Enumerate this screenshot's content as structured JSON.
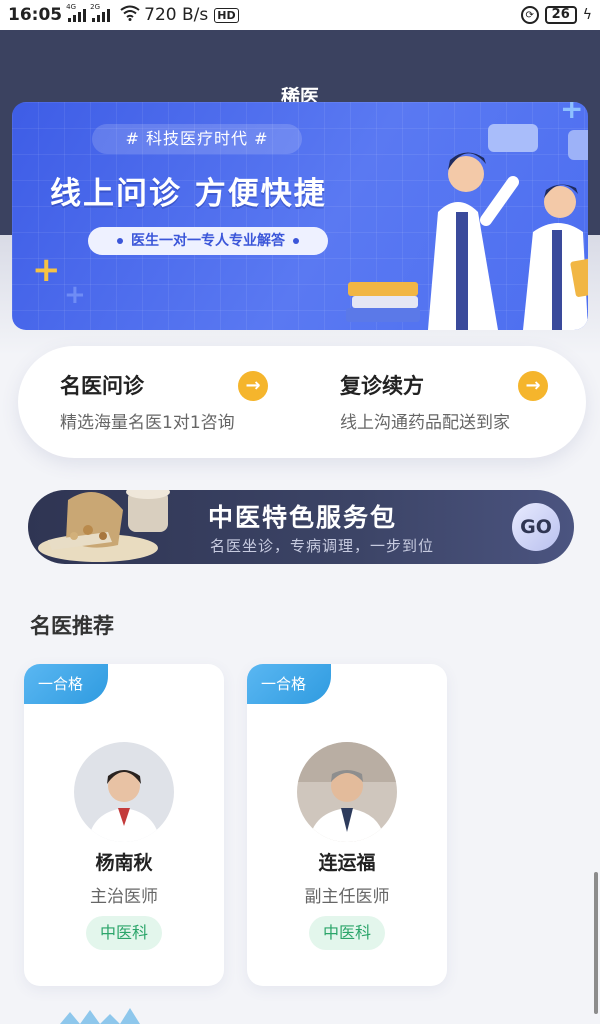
{
  "status_bar": {
    "time": "16:05",
    "network1": "4G",
    "network2": "2G",
    "speed": "720 B/s",
    "hd_label": "HD",
    "battery": "26"
  },
  "header": {
    "title": "稀医"
  },
  "banner": {
    "tagline": "# 科技医疗时代 #",
    "headline": "线上问诊 方便快捷",
    "pill_text": "医生一对一专人专业解答"
  },
  "services": [
    {
      "title": "名医问诊",
      "subtitle": "精选海量名医1对1咨询",
      "arrow": "→"
    },
    {
      "title": "复诊续方",
      "subtitle": "线上沟通药品配送到家",
      "arrow": "→"
    }
  ],
  "tcm_banner": {
    "title": "中医特色服务包",
    "subtitle": "名医坐诊，专病调理，一步到位",
    "button": "GO"
  },
  "section": {
    "title": "名医推荐"
  },
  "doctors": [
    {
      "badge": "一合格",
      "name": "杨南秋",
      "title": "主治医师",
      "department": "中医科"
    },
    {
      "badge": "一合格",
      "name": "连运福",
      "title": "副主任医师",
      "department": "中医科"
    }
  ],
  "colors": {
    "header_bg": "#3b4260",
    "banner_blue": "#4c6ef0",
    "accent_yellow": "#f5b52c",
    "dept_green": "#2ba56a",
    "badge_blue": "#2f9be0"
  }
}
